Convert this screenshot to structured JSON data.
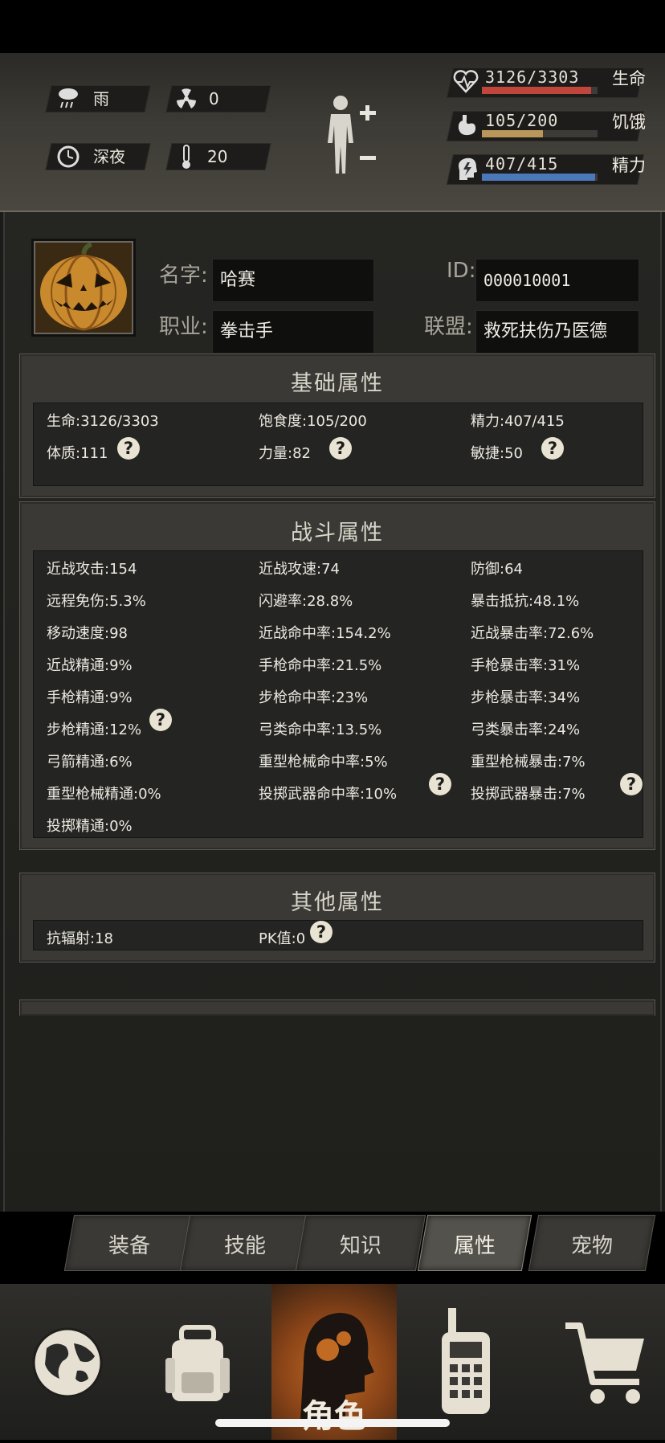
{
  "weather": {
    "label": "雨",
    "radiation": "0",
    "time": "深夜",
    "temperature": "20"
  },
  "vitals": [
    {
      "value": "3126/3303",
      "label": "生命",
      "fraction": 0.946,
      "color": "#c0463c"
    },
    {
      "value": "105/200",
      "label": "饥饿",
      "fraction": 0.525,
      "color": "#b9975a"
    },
    {
      "value": "407/415",
      "label": "精力",
      "fraction": 0.98,
      "color": "#4a78b8"
    }
  ],
  "profile": {
    "name_label": "名字:",
    "name": "哈赛",
    "id_label": "ID:",
    "id": "000010001",
    "job_label": "职业:",
    "job": "拳击手",
    "alliance_label": "联盟:",
    "alliance": "救死扶伤乃医德"
  },
  "basic": {
    "title": "基础属性",
    "rows": [
      [
        "生命:3126/3303",
        "饱食度:105/200",
        "精力:407/415"
      ],
      [
        "体质:111",
        "力量:82",
        "敏捷:50"
      ]
    ]
  },
  "combat": {
    "title": "战斗属性",
    "rows": [
      [
        "近战攻击:154",
        "近战攻速:74",
        "防御:64"
      ],
      [
        "远程免伤:5.3%",
        "闪避率:28.8%",
        "暴击抵抗:48.1%"
      ],
      [
        "移动速度:98",
        "近战命中率:154.2%",
        "近战暴击率:72.6%"
      ],
      [
        "近战精通:9%",
        "手枪命中率:21.5%",
        "手枪暴击率:31%"
      ],
      [
        "手枪精通:9%",
        "步枪命中率:23%",
        "步枪暴击率:34%"
      ],
      [
        "步枪精通:12%",
        "弓类命中率:13.5%",
        "弓类暴击率:24%"
      ],
      [
        "弓箭精通:6%",
        "重型枪械命中率:5%",
        "重型枪械暴击:7%"
      ],
      [
        "重型枪械精通:0%",
        "投掷武器命中率:10%",
        "投掷武器暴击:7%"
      ],
      [
        "投掷精通:0%",
        "",
        ""
      ]
    ]
  },
  "other": {
    "title": "其他属性",
    "rows": [
      [
        "抗辐射:18",
        "PK值:0"
      ]
    ]
  },
  "help_mark": "?",
  "tabs": [
    "装备",
    "技能",
    "知识",
    "属性",
    "宠物"
  ],
  "active_tab": "属性",
  "nav": {
    "active_label": "角色",
    "items": [
      "globe-icon",
      "backpack-icon",
      "character-icon",
      "radio-icon",
      "cart-icon"
    ]
  }
}
